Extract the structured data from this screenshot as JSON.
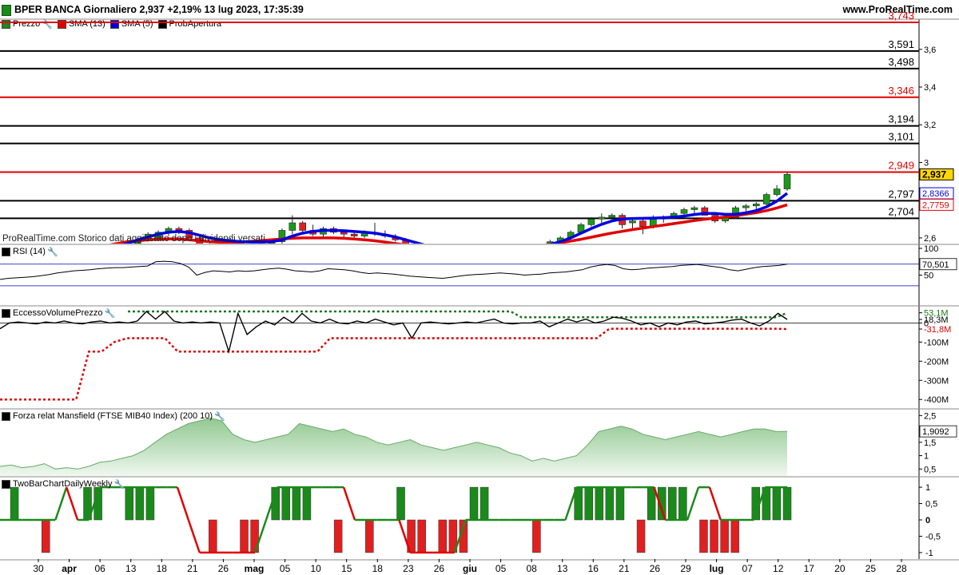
{
  "header": {
    "title": "BPER BANCA Giornaliero 2,937 +2,19% 13 lug 2023, 17:35:39",
    "site": "www.ProRealTime.com"
  },
  "legend": [
    {
      "label": "Prezzo",
      "color": "#1a8a1a"
    },
    {
      "label": "SMA (13)",
      "color": "#e00000"
    },
    {
      "label": "SMA (5)",
      "color": "#0000e0"
    },
    {
      "label": "ProbApertura",
      "color": "#000000"
    }
  ],
  "note": "ProRealTime.com Storico dati aggiustato dopo i dividendi versati",
  "panels": {
    "rsi": "RSI (14)",
    "volume": "EccessoVolumePrezzo",
    "mansfield": "Forza relat Mansfield (FTSE MIB40 Index) (200 10)",
    "twobar": "TwoBarChartDailyWeekly"
  },
  "chart_data": [
    {
      "type": "candlestick",
      "title": "BPER BANCA Giornaliero",
      "y_ticks": [
        "3,6",
        "3,4",
        "3,2",
        "3",
        "2,8",
        "2,6"
      ],
      "ylim": [
        2.57,
        3.76
      ],
      "levels": [
        {
          "label": "3,743",
          "value": 3.743,
          "color": "#e00000"
        },
        {
          "label": "3,591",
          "value": 3.591,
          "color": "#000000"
        },
        {
          "label": "3,498",
          "value": 3.498,
          "color": "#000000"
        },
        {
          "label": "3,346",
          "value": 3.346,
          "color": "#e00000"
        },
        {
          "label": "3,194",
          "value": 3.194,
          "color": "#000000"
        },
        {
          "label": "3,101",
          "value": 3.101,
          "color": "#000000"
        },
        {
          "label": "2,949",
          "value": 2.949,
          "color": "#e00000"
        },
        {
          "label": "2,797",
          "value": 2.797,
          "color": "#000000"
        },
        {
          "label": "2,704",
          "value": 2.704,
          "color": "#000000"
        }
      ],
      "last_values": [
        {
          "label": "2,937",
          "value": 2.937,
          "bg": "#ffd700",
          "color": "#000000"
        },
        {
          "label": "2,8366",
          "value": 2.8366,
          "bg": "#ffffff",
          "color": "#0000e0"
        },
        {
          "label": "2,7759",
          "value": 2.7759,
          "bg": "#ffffff",
          "color": "#e00000"
        }
      ],
      "x_labels": [
        "30",
        "apr",
        "06",
        "13",
        "18",
        "21",
        "26",
        "mag",
        "05",
        "10",
        "15",
        "18",
        "23",
        "26",
        "giu",
        "05",
        "08",
        "13",
        "16",
        "21",
        "26",
        "29",
        "lug",
        "07",
        "12",
        "17",
        "20",
        "25",
        "28"
      ],
      "bold_labels": [
        "apr",
        "mag",
        "giu",
        "lug"
      ],
      "candles": [
        {
          "o": 2.52,
          "h": 2.55,
          "l": 2.49,
          "c": 2.53
        },
        {
          "o": 2.52,
          "h": 2.56,
          "l": 2.5,
          "c": 2.55
        },
        {
          "o": 2.55,
          "h": 2.58,
          "l": 2.53,
          "c": 2.57
        },
        {
          "o": 2.57,
          "h": 2.6,
          "l": 2.55,
          "c": 2.59
        },
        {
          "o": 2.59,
          "h": 2.63,
          "l": 2.58,
          "c": 2.62
        },
        {
          "o": 2.6,
          "h": 2.64,
          "l": 2.59,
          "c": 2.63
        },
        {
          "o": 2.63,
          "h": 2.66,
          "l": 2.61,
          "c": 2.65
        },
        {
          "o": 2.65,
          "h": 2.66,
          "l": 2.62,
          "c": 2.64
        },
        {
          "o": 2.64,
          "h": 2.65,
          "l": 2.6,
          "c": 2.6
        },
        {
          "o": 2.6,
          "h": 2.62,
          "l": 2.55,
          "c": 2.56
        },
        {
          "o": 2.56,
          "h": 2.58,
          "l": 2.52,
          "c": 2.54
        },
        {
          "o": 2.53,
          "h": 2.57,
          "l": 2.52,
          "c": 2.56
        },
        {
          "o": 2.56,
          "h": 2.6,
          "l": 2.55,
          "c": 2.58
        },
        {
          "o": 2.58,
          "h": 2.59,
          "l": 2.54,
          "c": 2.55
        },
        {
          "o": 2.55,
          "h": 2.57,
          "l": 2.53,
          "c": 2.56
        },
        {
          "o": 2.56,
          "h": 2.58,
          "l": 2.54,
          "c": 2.57
        },
        {
          "o": 2.57,
          "h": 2.59,
          "l": 2.55,
          "c": 2.58
        },
        {
          "o": 2.58,
          "h": 2.65,
          "l": 2.57,
          "c": 2.64
        },
        {
          "o": 2.64,
          "h": 2.72,
          "l": 2.62,
          "c": 2.68
        },
        {
          "o": 2.68,
          "h": 2.69,
          "l": 2.62,
          "c": 2.64
        },
        {
          "o": 2.64,
          "h": 2.67,
          "l": 2.61,
          "c": 2.62
        },
        {
          "o": 2.62,
          "h": 2.66,
          "l": 2.6,
          "c": 2.65
        },
        {
          "o": 2.65,
          "h": 2.66,
          "l": 2.62,
          "c": 2.63
        },
        {
          "o": 2.63,
          "h": 2.64,
          "l": 2.6,
          "c": 2.62
        },
        {
          "o": 2.62,
          "h": 2.63,
          "l": 2.6,
          "c": 2.61
        },
        {
          "o": 2.61,
          "h": 2.64,
          "l": 2.6,
          "c": 2.63
        },
        {
          "o": 2.63,
          "h": 2.68,
          "l": 2.61,
          "c": 2.62
        },
        {
          "o": 2.62,
          "h": 2.64,
          "l": 2.6,
          "c": 2.61
        },
        {
          "o": 2.6,
          "h": 2.62,
          "l": 2.58,
          "c": 2.59
        },
        {
          "o": 2.59,
          "h": 2.6,
          "l": 2.55,
          "c": 2.56
        },
        {
          "o": 2.56,
          "h": 2.58,
          "l": 2.53,
          "c": 2.55
        },
        {
          "o": 2.55,
          "h": 2.57,
          "l": 2.52,
          "c": 2.54
        },
        {
          "o": 2.54,
          "h": 2.56,
          "l": 2.5,
          "c": 2.51
        },
        {
          "o": 2.51,
          "h": 2.53,
          "l": 2.48,
          "c": 2.5
        },
        {
          "o": 2.5,
          "h": 2.52,
          "l": 2.48,
          "c": 2.51
        },
        {
          "o": 2.51,
          "h": 2.53,
          "l": 2.5,
          "c": 2.52
        },
        {
          "o": 2.52,
          "h": 2.56,
          "l": 2.51,
          "c": 2.55
        },
        {
          "o": 2.55,
          "h": 2.56,
          "l": 2.53,
          "c": 2.54
        },
        {
          "o": 2.54,
          "h": 2.56,
          "l": 2.52,
          "c": 2.55
        },
        {
          "o": 2.55,
          "h": 2.56,
          "l": 2.53,
          "c": 2.56
        },
        {
          "o": 2.55,
          "h": 2.56,
          "l": 2.53,
          "c": 2.54
        },
        {
          "o": 2.54,
          "h": 2.55,
          "l": 2.52,
          "c": 2.55
        },
        {
          "o": 2.55,
          "h": 2.56,
          "l": 2.54,
          "c": 2.56
        },
        {
          "o": 2.56,
          "h": 2.59,
          "l": 2.55,
          "c": 2.58
        },
        {
          "o": 2.58,
          "h": 2.61,
          "l": 2.57,
          "c": 2.6
        },
        {
          "o": 2.6,
          "h": 2.64,
          "l": 2.59,
          "c": 2.63
        },
        {
          "o": 2.63,
          "h": 2.68,
          "l": 2.62,
          "c": 2.67
        },
        {
          "o": 2.67,
          "h": 2.71,
          "l": 2.66,
          "c": 2.7
        },
        {
          "o": 2.7,
          "h": 2.73,
          "l": 2.68,
          "c": 2.71
        },
        {
          "o": 2.71,
          "h": 2.73,
          "l": 2.69,
          "c": 2.72
        },
        {
          "o": 2.72,
          "h": 2.73,
          "l": 2.65,
          "c": 2.67
        },
        {
          "o": 2.68,
          "h": 2.7,
          "l": 2.64,
          "c": 2.69
        },
        {
          "o": 2.69,
          "h": 2.7,
          "l": 2.62,
          "c": 2.66
        },
        {
          "o": 2.66,
          "h": 2.72,
          "l": 2.65,
          "c": 2.7
        },
        {
          "o": 2.7,
          "h": 2.72,
          "l": 2.68,
          "c": 2.71
        },
        {
          "o": 2.71,
          "h": 2.74,
          "l": 2.7,
          "c": 2.73
        },
        {
          "o": 2.73,
          "h": 2.76,
          "l": 2.72,
          "c": 2.75
        },
        {
          "o": 2.75,
          "h": 2.77,
          "l": 2.73,
          "c": 2.76
        },
        {
          "o": 2.76,
          "h": 2.77,
          "l": 2.72,
          "c": 2.72
        },
        {
          "o": 2.72,
          "h": 2.73,
          "l": 2.68,
          "c": 2.69
        },
        {
          "o": 2.69,
          "h": 2.72,
          "l": 2.68,
          "c": 2.71
        },
        {
          "o": 2.71,
          "h": 2.77,
          "l": 2.7,
          "c": 2.76
        },
        {
          "o": 2.76,
          "h": 2.78,
          "l": 2.74,
          "c": 2.77
        },
        {
          "o": 2.77,
          "h": 2.79,
          "l": 2.74,
          "c": 2.78
        },
        {
          "o": 2.78,
          "h": 2.84,
          "l": 2.77,
          "c": 2.83
        },
        {
          "o": 2.83,
          "h": 2.88,
          "l": 2.82,
          "c": 2.86
        },
        {
          "o": 2.86,
          "h": 2.95,
          "l": 2.85,
          "c": 2.937
        }
      ],
      "sma13": [
        2.56,
        2.57,
        2.58,
        2.585,
        2.59,
        2.593,
        2.595,
        2.594,
        2.59,
        2.585,
        2.58,
        2.577,
        2.576,
        2.578,
        2.582,
        2.586,
        2.59,
        2.594,
        2.598,
        2.6,
        2.6,
        2.6,
        2.6,
        2.598,
        2.594,
        2.59,
        2.585,
        2.578,
        2.57,
        2.563,
        2.558,
        2.553,
        2.548,
        2.545,
        2.543,
        2.542,
        2.542,
        2.543,
        2.545,
        2.548,
        2.551,
        2.555,
        2.56,
        2.566,
        2.574,
        2.583,
        2.593,
        2.604,
        2.615,
        2.626,
        2.635,
        2.644,
        2.652,
        2.66,
        2.668,
        2.676,
        2.684,
        2.692,
        2.699,
        2.705,
        2.711,
        2.718,
        2.726,
        2.734,
        2.745,
        2.759,
        2.776
      ],
      "sma5": [
        2.54,
        2.555,
        2.57,
        2.59,
        2.605,
        2.62,
        2.63,
        2.634,
        2.628,
        2.614,
        2.6,
        2.59,
        2.585,
        2.58,
        2.578,
        2.578,
        2.58,
        2.59,
        2.61,
        2.625,
        2.635,
        2.64,
        2.64,
        2.638,
        2.634,
        2.63,
        2.625,
        2.616,
        2.605,
        2.59,
        2.575,
        2.56,
        2.546,
        2.535,
        2.53,
        2.528,
        2.53,
        2.535,
        2.54,
        2.545,
        2.548,
        2.55,
        2.555,
        2.565,
        2.58,
        2.6,
        2.625,
        2.65,
        2.672,
        2.69,
        2.7,
        2.703,
        2.704,
        2.705,
        2.707,
        2.71,
        2.716,
        2.724,
        2.73,
        2.73,
        2.725,
        2.726,
        2.733,
        2.745,
        2.765,
        2.795,
        2.837
      ]
    },
    {
      "type": "line",
      "title": "RSI (14)",
      "y_ticks": [
        "100",
        "50"
      ],
      "ylim": [
        0,
        100
      ],
      "last_value": "70,501",
      "values": [
        42,
        44,
        45,
        46,
        47,
        49,
        51,
        54,
        56,
        58,
        59,
        60,
        62,
        63,
        64,
        64,
        65,
        66,
        67,
        75,
        76,
        75,
        72,
        65,
        50,
        55,
        58,
        57,
        56,
        58,
        57,
        58,
        60,
        62,
        63,
        61,
        58,
        57,
        56,
        58,
        62,
        61,
        60,
        58,
        55,
        53,
        54,
        53,
        52,
        50,
        48,
        47,
        46,
        45,
        44,
        46,
        48,
        50,
        51,
        52,
        53,
        54,
        53,
        52,
        50,
        51,
        52,
        54,
        55,
        56,
        58,
        60,
        65,
        68,
        70,
        68,
        62,
        60,
        61,
        63,
        64,
        65,
        66,
        68,
        69,
        70,
        68,
        66,
        64,
        60,
        58,
        61,
        64,
        66,
        67,
        68,
        70.5
      ]
    },
    {
      "type": "line",
      "title": "EccessoVolumePrezzo",
      "y_ticks": [
        "53,1M",
        "18,3M",
        "0",
        "-31,8M",
        "-100M",
        "-200M",
        "-300M",
        "-400M"
      ],
      "ylim": [
        -420,
        60
      ],
      "upper_last": "53,1M",
      "main_last": "18,3M",
      "lower_last": "-31,8M",
      "main": [
        -30,
        0,
        5,
        0,
        -5,
        5,
        0,
        10,
        0,
        -5,
        5,
        10,
        0,
        5,
        0,
        10,
        60,
        20,
        60,
        10,
        0,
        5,
        0,
        5,
        0,
        -150,
        50,
        -60,
        -20,
        10,
        -10,
        30,
        0,
        50,
        10,
        0,
        20,
        0,
        -5,
        10,
        0,
        20,
        5,
        -10,
        0,
        -80,
        0,
        5,
        0,
        -5,
        0,
        5,
        0,
        10,
        20,
        0,
        -5,
        0,
        0,
        10,
        -20,
        0,
        20,
        5,
        20,
        0,
        10,
        30,
        25,
        10,
        -10,
        0,
        -20,
        0,
        -10,
        5,
        10,
        -5,
        0,
        5,
        15,
        20,
        0,
        -15,
        10,
        50,
        18.3
      ],
      "upper": [
        60,
        60,
        60,
        60,
        60,
        60,
        60,
        60,
        60,
        60,
        60,
        60,
        60,
        60,
        60,
        60,
        60,
        60,
        60,
        60,
        60,
        60,
        60,
        60,
        60,
        60,
        60,
        60,
        60,
        60,
        60,
        60,
        60,
        60,
        60,
        60,
        60,
        30,
        30,
        30,
        30,
        30,
        30,
        30,
        30,
        30,
        30,
        30,
        30,
        30,
        30,
        30,
        30,
        30,
        30,
        30,
        30,
        30,
        30,
        30,
        30,
        30,
        53.1
      ],
      "lower": [
        -400,
        -400,
        -400,
        -400,
        -400,
        -400,
        -400,
        -150,
        -150,
        -100,
        -80,
        -80,
        -80,
        -80,
        -150,
        -150,
        -150,
        -150,
        -150,
        -150,
        -150,
        -150,
        -150,
        -150,
        -150,
        -150,
        -80,
        -80,
        -80,
        -80,
        -80,
        -80,
        -80,
        -80,
        -80,
        -80,
        -80,
        -80,
        -80,
        -80,
        -80,
        -80,
        -80,
        -80,
        -80,
        -80,
        -80,
        -80,
        -30,
        -30,
        -30,
        -30,
        -30,
        -30,
        -30,
        -30,
        -30,
        -30,
        -30,
        -30,
        -30,
        -30,
        -31.8
      ]
    },
    {
      "type": "area",
      "title": "Forza relat Mansfield (FTSE MIB40 Index) (200 10)",
      "y_ticks": [
        "2,5",
        "2",
        "1,5",
        "1",
        "0,5"
      ],
      "ylim": [
        0.3,
        2.6
      ],
      "last_value": "1,9092",
      "values": [
        0.6,
        0.65,
        0.55,
        0.6,
        0.7,
        0.5,
        0.55,
        0.5,
        0.6,
        0.75,
        0.8,
        0.9,
        1.0,
        1.2,
        1.5,
        1.8,
        2.0,
        2.2,
        2.3,
        2.4,
        2.3,
        1.8,
        1.6,
        1.5,
        1.6,
        1.7,
        1.8,
        2.2,
        2.1,
        2.0,
        1.9,
        2.0,
        1.8,
        1.7,
        1.5,
        1.4,
        1.5,
        1.6,
        1.4,
        1.3,
        1.2,
        1.3,
        1.4,
        1.5,
        1.4,
        1.3,
        1.1,
        1.0,
        0.8,
        0.9,
        0.8,
        0.9,
        1.0,
        1.4,
        1.9,
        2.0,
        2.1,
        2.0,
        1.8,
        1.7,
        1.6,
        1.7,
        1.8,
        1.9,
        1.8,
        1.7,
        1.8,
        1.9,
        2.0,
        2.0,
        1.9,
        1.9092
      ]
    },
    {
      "type": "bar",
      "title": "TwoBarChartDailyWeekly",
      "y_ticks": [
        "1",
        "0,5",
        "0",
        "-0,5",
        "-1"
      ],
      "ylim": [
        -1.3,
        1.3
      ],
      "last_value": "1",
      "bars": [
        0,
        1,
        0,
        0,
        -1,
        0,
        0,
        0,
        1,
        1,
        0,
        0,
        1,
        1,
        1,
        0,
        0,
        0,
        0,
        0,
        -1,
        0,
        0,
        -1,
        -1,
        0,
        1,
        1,
        1,
        1,
        0,
        0,
        -1,
        0,
        0,
        -1,
        0,
        0,
        1,
        -1,
        -1,
        0,
        -1,
        -1,
        -1,
        1,
        1,
        0,
        0,
        0,
        0,
        -1,
        0,
        0,
        0,
        1,
        1,
        1,
        1,
        1,
        0,
        -1,
        1,
        1,
        1,
        1,
        0,
        -1,
        -1,
        -1,
        -1,
        0,
        1,
        1,
        1,
        1
      ],
      "line": [
        0,
        0,
        0,
        0,
        0,
        0,
        1,
        0,
        0,
        1,
        1,
        1,
        1,
        1,
        1,
        1,
        1,
        0,
        -1,
        -1,
        -1,
        -1,
        -1,
        -1,
        0,
        1,
        1,
        1,
        1,
        1,
        1,
        1,
        0,
        0,
        0,
        0,
        0,
        -1,
        -1,
        -1,
        -1,
        -1,
        0,
        0,
        0,
        0,
        0,
        0,
        0,
        0,
        0,
        0,
        1,
        1,
        1,
        1,
        1,
        1,
        1,
        1,
        0,
        0,
        0,
        1,
        1,
        0,
        0,
        0,
        0,
        1,
        1,
        1
      ]
    }
  ]
}
